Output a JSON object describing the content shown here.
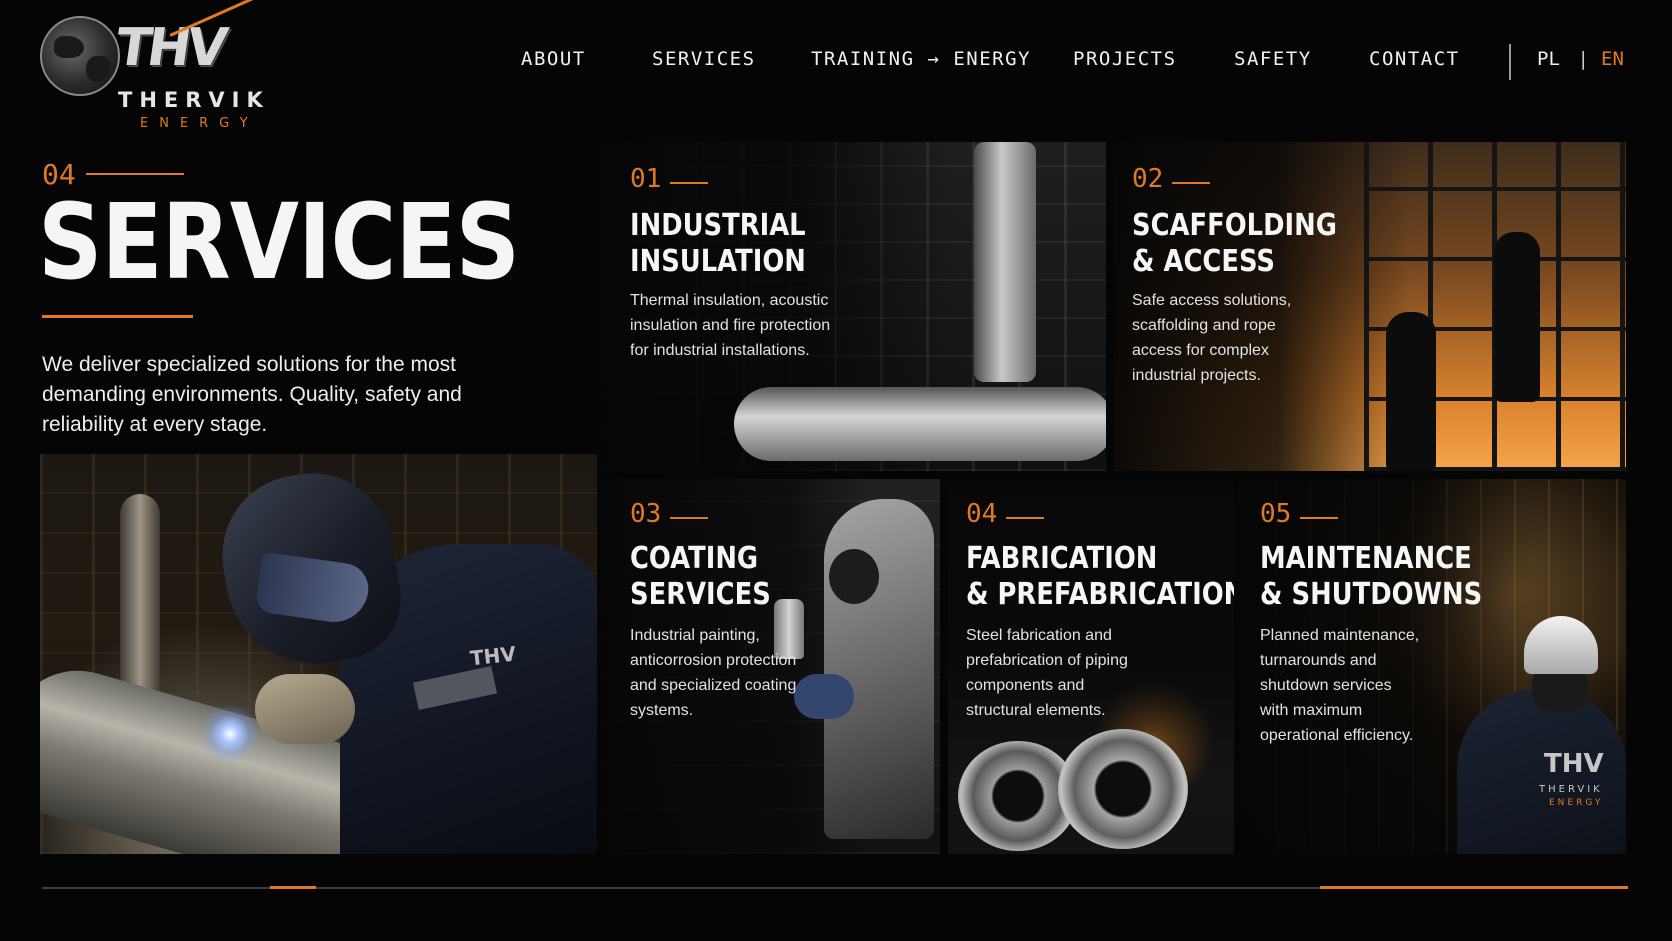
{
  "brand": {
    "mark": "THV",
    "name": "THERVIK",
    "sub": "ENERGY"
  },
  "nav": {
    "items": [
      "ABOUT",
      "SERVICES",
      "TRAINING → ENERGY",
      "PROJECTS",
      "SAFETY",
      "CONTACT"
    ],
    "languages": {
      "pl": "PL",
      "separator": "|",
      "en": "EN",
      "active": "EN"
    }
  },
  "intro": {
    "section_number": "04",
    "title": "SERVICES",
    "description": "We deliver specialized solutions for the most demanding environments. Quality, safety and reliability at every stage."
  },
  "hero": {
    "badge": "THV"
  },
  "services": [
    {
      "number": "01",
      "title_line1": "INDUSTRIAL",
      "title_line2": "INSULATION",
      "description": "Thermal insulation, acoustic insulation and fire protection for industrial installations."
    },
    {
      "number": "02",
      "title_line1": "SCAFFOLDING",
      "title_line2": "& ACCESS",
      "description": "Safe access solutions, scaffolding and rope access for complex industrial projects."
    },
    {
      "number": "03",
      "title_line1": "COATING",
      "title_line2": "SERVICES",
      "description": "Industrial painting, anticorrosion protection and specialized coating systems."
    },
    {
      "number": "04",
      "title_line1": "FABRICATION",
      "title_line2": "& PREFABRICATION",
      "description": "Steel fabrication and prefabrication of piping components and structural elements."
    },
    {
      "number": "05",
      "title_line1": "MAINTENANCE",
      "title_line2": "& SHUTDOWNS",
      "description": "Planned maintenance, turnarounds and shutdown services with maximum operational efficiency."
    }
  ],
  "card5_badge": {
    "mark": "THV",
    "name": "THERVIK",
    "sub": "ENERGY"
  },
  "colors": {
    "accent": "#e07a22",
    "background": "#050505",
    "text": "#f5f5f5"
  }
}
